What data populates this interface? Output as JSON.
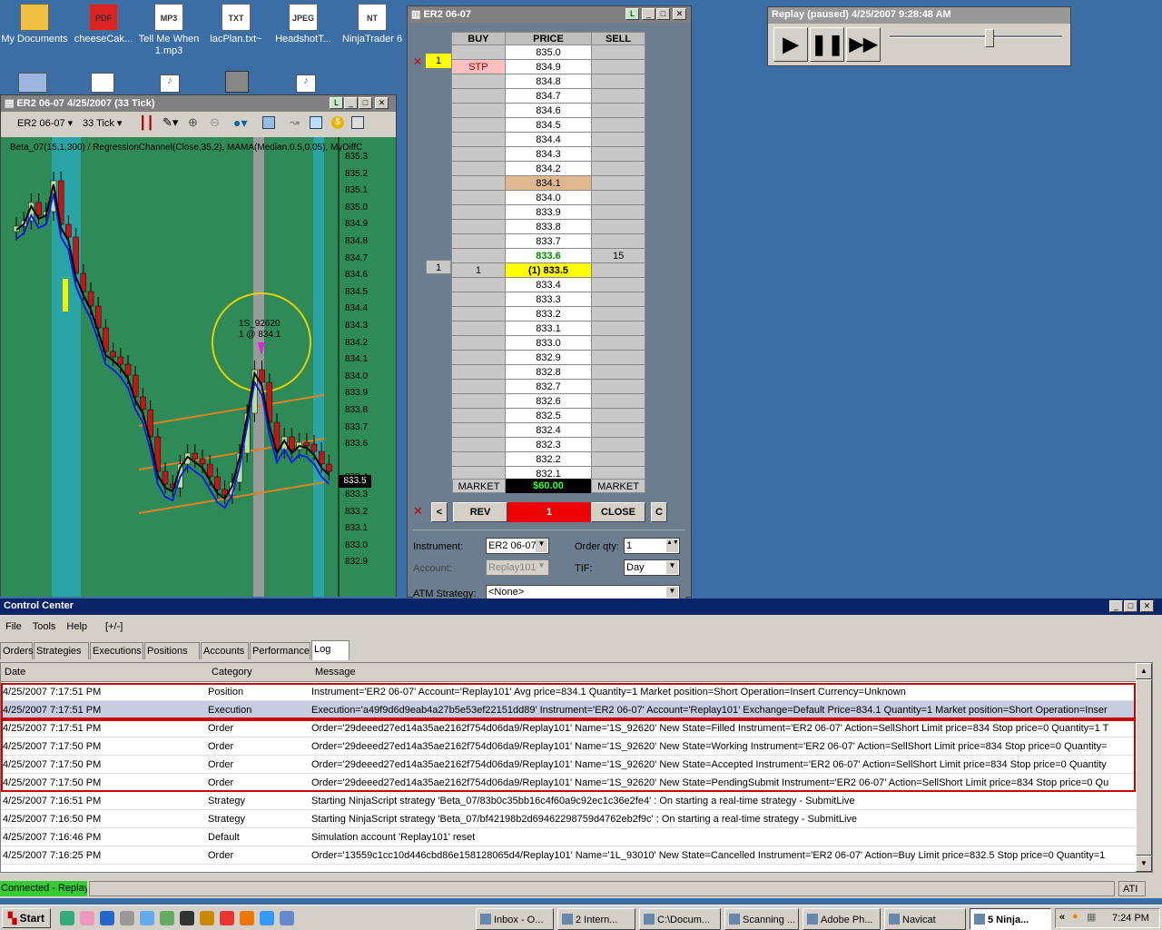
{
  "desktop": {
    "icons": [
      {
        "label": "My Documents",
        "badge": ""
      },
      {
        "label": "cheeseCak...",
        "badge": "PDF"
      },
      {
        "label": "Tell Me When 1.mp3",
        "badge": "MP3"
      },
      {
        "label": "lacPlan.txt~",
        "badge": "TXT"
      },
      {
        "label": "HeadshotT...",
        "badge": "JPEG"
      },
      {
        "label": "NinjaTrader 6",
        "badge": "NT"
      }
    ]
  },
  "chart_window": {
    "title": "ER2 06-07  4/25/2007  (33 Tick)",
    "instrument": "ER2 06-07",
    "interval": "33 Tick",
    "indicator_line": "Beta_07(15,1,300) / RegressionChannel(Close,35,2), MAMA(Median,0.5,0.05), MyDiffC",
    "marker_label": "1S_92620",
    "marker_sub": "1 @ 834.1",
    "current_price": "833.5",
    "y_ticks": [
      "835.3",
      "835.2",
      "835.1",
      "835.0",
      "834.9",
      "834.8",
      "834.7",
      "834.6",
      "834.5",
      "834.4",
      "834.3",
      "834.2",
      "834.1",
      "834.0",
      "833.9",
      "833.8",
      "833.7",
      "833.6",
      "833.4",
      "833.3",
      "833.2",
      "833.1",
      "833.0",
      "832.9"
    ]
  },
  "dom_window": {
    "title": "ER2 06-07",
    "headers": {
      "buy": "BUY",
      "price": "PRICE",
      "sell": "SELL"
    },
    "rows": [
      {
        "buy": "",
        "price": "835.0",
        "sell": ""
      },
      {
        "buy": "STP",
        "price": "834.9",
        "sell": "",
        "qty": "1",
        "hl": "stp"
      },
      {
        "buy": "",
        "price": "834.8",
        "sell": ""
      },
      {
        "buy": "",
        "price": "834.7",
        "sell": ""
      },
      {
        "buy": "",
        "price": "834.6",
        "sell": ""
      },
      {
        "buy": "",
        "price": "834.5",
        "sell": ""
      },
      {
        "buy": "",
        "price": "834.4",
        "sell": ""
      },
      {
        "buy": "",
        "price": "834.3",
        "sell": ""
      },
      {
        "buy": "",
        "price": "834.2",
        "sell": ""
      },
      {
        "buy": "",
        "price": "834.1",
        "sell": "",
        "hl": "entry"
      },
      {
        "buy": "",
        "price": "834.0",
        "sell": ""
      },
      {
        "buy": "",
        "price": "833.9",
        "sell": ""
      },
      {
        "buy": "",
        "price": "833.8",
        "sell": ""
      },
      {
        "buy": "",
        "price": "833.7",
        "sell": ""
      },
      {
        "buy": "",
        "price": "833.6",
        "sell": "15",
        "hl": "ask"
      },
      {
        "buy": "1",
        "price": "(1) 833.5",
        "sell": "",
        "hl": "last"
      },
      {
        "buy": "",
        "price": "833.4",
        "sell": ""
      },
      {
        "buy": "",
        "price": "833.3",
        "sell": ""
      },
      {
        "buy": "",
        "price": "833.2",
        "sell": ""
      },
      {
        "buy": "",
        "price": "833.1",
        "sell": ""
      },
      {
        "buy": "",
        "price": "833.0",
        "sell": ""
      },
      {
        "buy": "",
        "price": "832.9",
        "sell": ""
      },
      {
        "buy": "",
        "price": "832.8",
        "sell": ""
      },
      {
        "buy": "",
        "price": "832.7",
        "sell": ""
      },
      {
        "buy": "",
        "price": "832.6",
        "sell": ""
      },
      {
        "buy": "",
        "price": "832.5",
        "sell": ""
      },
      {
        "buy": "",
        "price": "832.4",
        "sell": ""
      },
      {
        "buy": "",
        "price": "832.3",
        "sell": ""
      },
      {
        "buy": "",
        "price": "832.2",
        "sell": ""
      },
      {
        "buy": "",
        "price": "832.1",
        "sell": ""
      }
    ],
    "market_buy": "MARKET",
    "pnl": "$60.00",
    "market_sell": "MARKET",
    "rev": "REV",
    "position_qty": "1",
    "close": "CLOSE",
    "left_btn": "<",
    "c_btn": "C",
    "instrument_label": "Instrument:",
    "instrument_value": "ER2 06-07",
    "account_label": "Account:",
    "account_value": "Replay101",
    "order_qty_label": "Order qty:",
    "order_qty_value": "1",
    "tif_label": "TIF:",
    "tif_value": "Day",
    "atm_label": "ATM Strategy:",
    "atm_value": "<None>"
  },
  "replay": {
    "title": "Replay (paused) 4/25/2007 9:28:48 AM",
    "slider_value_pct": 58
  },
  "control_center": {
    "title": "Control Center",
    "menu": [
      "File",
      "Tools",
      "Help",
      "[+/-]"
    ],
    "tabs": [
      "Orders",
      "Strategies",
      "Executions",
      "Positions",
      "Accounts",
      "Performance",
      "Log"
    ],
    "active_tab": "Log",
    "columns": [
      "Date",
      "Category",
      "Message"
    ],
    "rows": [
      {
        "date": "4/25/2007 7:17:51 PM",
        "category": "Position",
        "message": "Instrument='ER2 06-07' Account='Replay101' Avg price=834.1 Quantity=1 Market position=Short Operation=Insert Currency=Unknown"
      },
      {
        "date": "4/25/2007 7:17:51 PM",
        "category": "Execution",
        "message": "Execution='a49f9d6d9eab4a27b5e53ef22151dd89' Instrument='ER2 06-07' Account='Replay101' Exchange=Default Price=834.1 Quantity=1 Market position=Short Operation=Inser"
      },
      {
        "date": "4/25/2007 7:17:51 PM",
        "category": "Order",
        "message": "Order='29deeed27ed14a35ae2162f754d06da9/Replay101' Name='1S_92620' New State=Filled Instrument='ER2 06-07' Action=SellShort Limit price=834 Stop price=0 Quantity=1 T"
      },
      {
        "date": "4/25/2007 7:17:50 PM",
        "category": "Order",
        "message": "Order='29deeed27ed14a35ae2162f754d06da9/Replay101' Name='1S_92620' New State=Working Instrument='ER2 06-07' Action=SellShort Limit price=834 Stop price=0 Quantity="
      },
      {
        "date": "4/25/2007 7:17:50 PM",
        "category": "Order",
        "message": "Order='29deeed27ed14a35ae2162f754d06da9/Replay101' Name='1S_92620' New State=Accepted Instrument='ER2 06-07' Action=SellShort Limit price=834 Stop price=0 Quantity"
      },
      {
        "date": "4/25/2007 7:17:50 PM",
        "category": "Order",
        "message": "Order='29deeed27ed14a35ae2162f754d06da9/Replay101' Name='1S_92620' New State=PendingSubmit Instrument='ER2 06-07' Action=SellShort Limit price=834 Stop price=0 Qu"
      },
      {
        "date": "4/25/2007 7:16:51 PM",
        "category": "Strategy",
        "message": "Starting NinjaScript strategy 'Beta_07/83b0c35bb16c4f60a9c92ec1c36e2fe4' : On starting a real-time strategy - SubmitLive"
      },
      {
        "date": "4/25/2007 7:16:50 PM",
        "category": "Strategy",
        "message": "Starting NinjaScript strategy 'Beta_07/bf42198b2d69462298759d4762eb2f9c' : On starting a real-time strategy - SubmitLive"
      },
      {
        "date": "4/25/2007 7:16:46 PM",
        "category": "Default",
        "message": "Simulation account 'Replay101' reset"
      },
      {
        "date": "4/25/2007 7:16:25 PM",
        "category": "Order",
        "message": "Order='13559c1cc10d446cbd86e158128065d4/Replay101' Name='1L_93010' New State=Cancelled Instrument='ER2 06-07' Action=Buy Limit price=832.5 Stop price=0 Quantity=1"
      }
    ],
    "status": "Connected - Replay",
    "status_right": "ATI"
  },
  "taskbar": {
    "start": "Start",
    "tasks": [
      "Inbox - O...",
      "2 Intern...",
      "C:\\Docum...",
      "Scanning ...",
      "Adobe Ph...",
      "Navicat",
      "5 Ninja..."
    ],
    "clock": "7:24 PM"
  }
}
